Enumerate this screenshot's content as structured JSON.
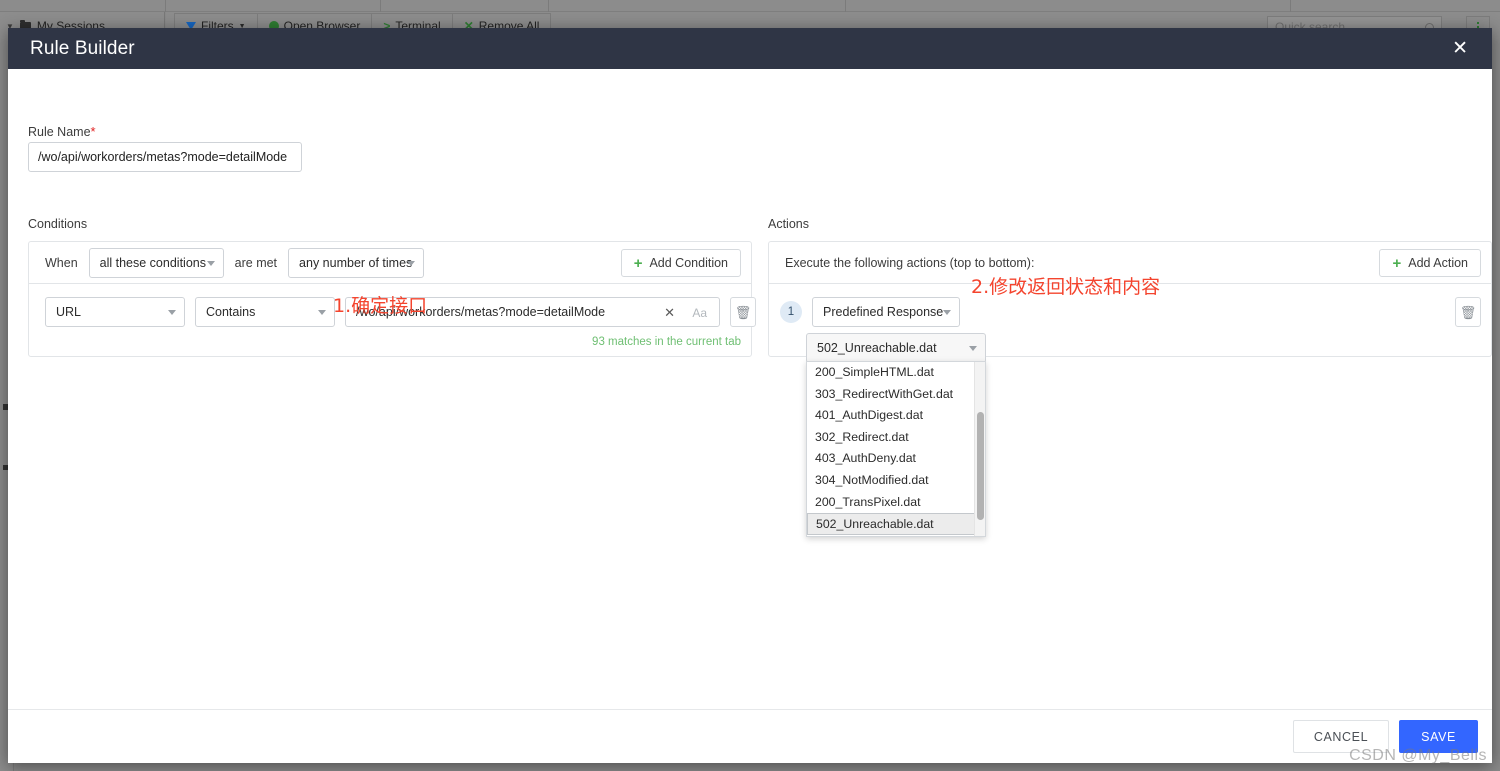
{
  "backdrop": {
    "sidebar_label": "My Sessions",
    "toolbar_buttons": [
      {
        "label": "Filters",
        "icon": "filter-icon"
      },
      {
        "label": "Open Browser",
        "icon": "globe-icon"
      },
      {
        "label": "Terminal",
        "icon": "terminal-icon"
      },
      {
        "label": "Remove All",
        "icon": "x-icon"
      }
    ],
    "search_placeholder": "Quick search"
  },
  "dialog": {
    "title": "Rule Builder",
    "close_label": "✕",
    "rule_name": {
      "label": "Rule Name",
      "required_mark": "*",
      "value": "/wo/api/workorders/metas?mode=detailMode"
    },
    "conditions": {
      "section_label": "Conditions",
      "when_label": "When",
      "match_type": "all these conditions",
      "are_met_label": "are met",
      "occurrence": "any number of times",
      "add_button": "Add Condition",
      "rows": [
        {
          "field": "URL",
          "operator": "Contains",
          "value": "/wo/api/workorders/metas?mode=detailMode",
          "clear_icon": "✕",
          "case_icon": "Aa",
          "delete_icon": "Ὕ1"
        }
      ],
      "match_note": "93 matches in the current tab"
    },
    "actions": {
      "section_label": "Actions",
      "header_text": "Execute the following actions (top to bottom):",
      "add_button": "Add Action",
      "rows": [
        {
          "index": "1",
          "type": "Predefined Response",
          "response_file": "502_Unreachable.dat"
        }
      ]
    },
    "dropdown": {
      "selected": "502_Unreachable.dat",
      "options": [
        "200_SimpleHTML.dat",
        "303_RedirectWithGet.dat",
        "401_AuthDigest.dat",
        "302_Redirect.dat",
        "403_AuthDeny.dat",
        "304_NotModified.dat",
        "200_TransPixel.dat",
        "502_Unreachable.dat"
      ]
    },
    "footer": {
      "cancel_label": "CANCEL",
      "save_label": "SAVE"
    }
  },
  "annotations": [
    {
      "text": "1.确定接口",
      "color": "#f4442e"
    },
    {
      "text": "2.修改返回状态和内容",
      "color": "#f4442e"
    }
  ],
  "watermark": "CSDN @My_Bells"
}
